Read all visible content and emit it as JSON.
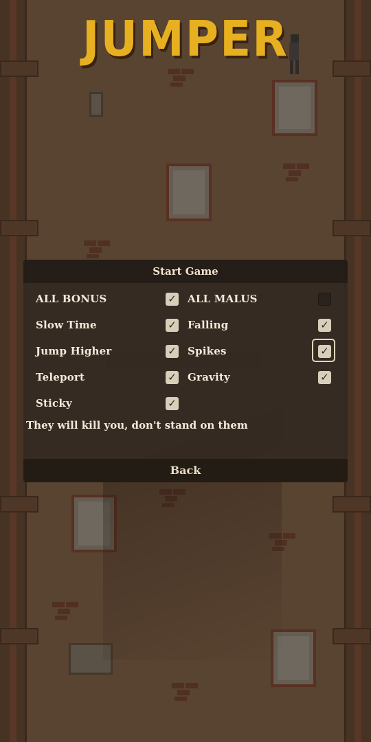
{
  "game": {
    "title": "JUMPER"
  },
  "menu": {
    "header": "Start Game",
    "options_left": [
      {
        "label": "ALL BONUS",
        "checked": true
      },
      {
        "label": "Slow Time",
        "checked": true
      },
      {
        "label": "Jump Higher",
        "checked": true
      },
      {
        "label": "Teleport",
        "checked": true
      },
      {
        "label": "Sticky",
        "checked": true
      }
    ],
    "options_right": [
      {
        "label": "ALL MALUS",
        "checked": false
      },
      {
        "label": "Falling",
        "checked": true
      },
      {
        "label": "Spikes",
        "checked": true,
        "focused": true
      },
      {
        "label": "Gravity",
        "checked": true
      }
    ],
    "description": "They will kill you, don't stand on them",
    "back_label": "Back"
  },
  "icons": {
    "check": "checkmark-icon"
  },
  "colors": {
    "title": "#e6b020",
    "panel": "#342a22",
    "text": "#f2ead8"
  }
}
